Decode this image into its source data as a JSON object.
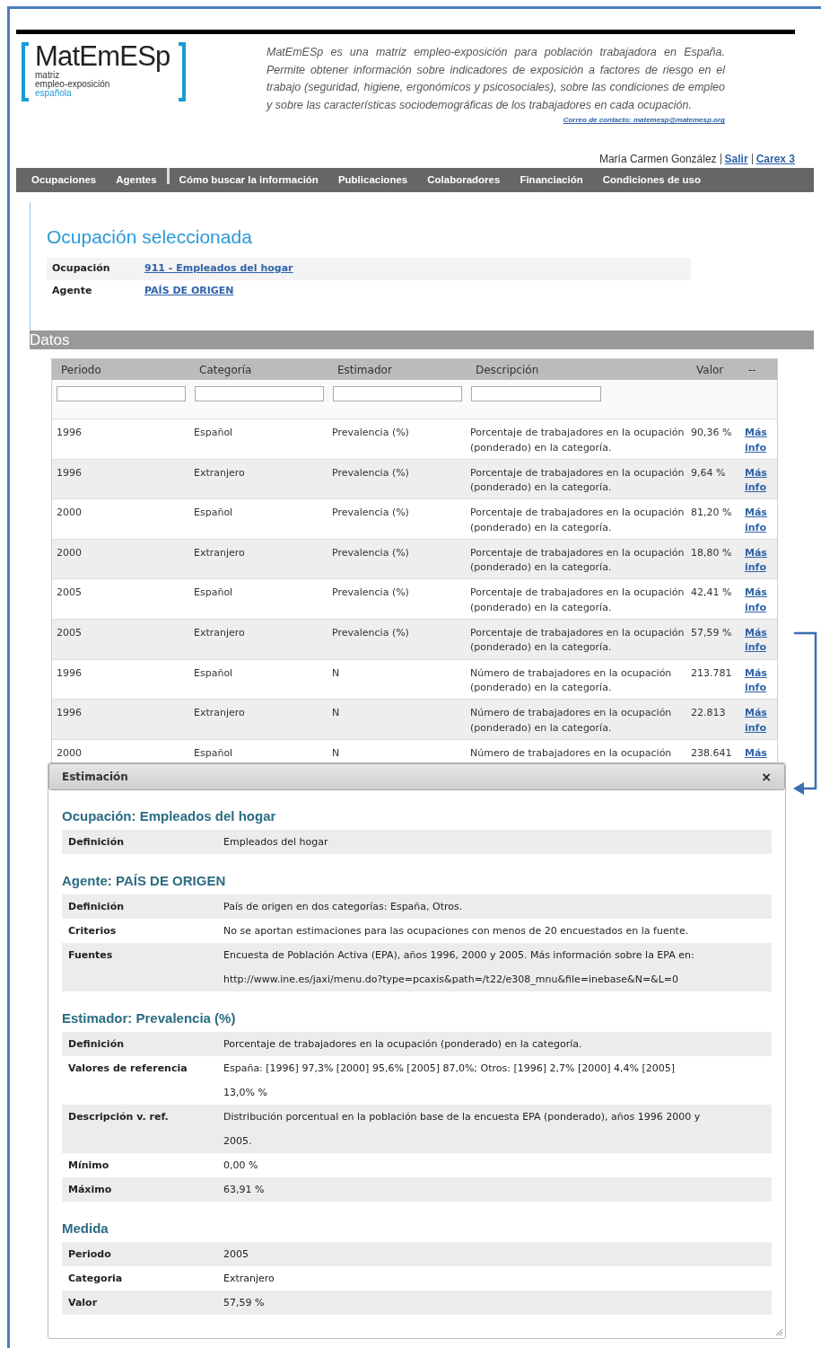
{
  "logo": {
    "title": "MatEmESp",
    "lines": [
      "matriz",
      "empleo-exposición"
    ],
    "accent_line": "española"
  },
  "intro": "MatEmESp es una matriz empleo-exposición para población trabajadora en España. Permite obtener información sobre indicadores de exposición a factores de riesgo en el trabajo (seguridad, higiene, ergonómicos y psicosociales), sobre las condiciones de empleo y sobre las características sociodemográficas de los trabajadores en cada ocupación.",
  "contact": "Correo de contacto: matemesp@matemesp.org",
  "user": {
    "name": "María Carmen González",
    "links": [
      "Salir",
      "Carex 3"
    ]
  },
  "nav": [
    "Ocupaciones",
    "Agentes",
    "Cómo buscar la información",
    "Publicaciones",
    "Colaboradores",
    "Financiación",
    "Condiciones de uso"
  ],
  "selection": {
    "title": "Ocupación seleccionada",
    "rows": [
      {
        "label": "Ocupación",
        "value": "911 - Empleados del hogar"
      },
      {
        "label": "Agente",
        "value": "PAÍS DE ORIGEN"
      }
    ]
  },
  "datos": {
    "title": "Datos",
    "columns": [
      "Periodo",
      "Categoría",
      "Estimador",
      "Descripción",
      "Valor",
      "--"
    ],
    "rows": [
      {
        "periodo": "1996",
        "categoria": "Español",
        "estimador": "Prevalencia (%)",
        "descripcion": "Porcentaje de trabajadores en la ocupación (ponderado) en la categoría.",
        "valor": "90,36 %",
        "link": "Más info"
      },
      {
        "periodo": "1996",
        "categoria": "Extranjero",
        "estimador": "Prevalencia (%)",
        "descripcion": "Porcentaje de trabajadores en la ocupación (ponderado) en la categoría.",
        "valor": "9,64 %",
        "link": "Más info"
      },
      {
        "periodo": "2000",
        "categoria": "Español",
        "estimador": "Prevalencia (%)",
        "descripcion": "Porcentaje de trabajadores en la ocupación (ponderado) en la categoría.",
        "valor": "81,20 %",
        "link": "Más info"
      },
      {
        "periodo": "2000",
        "categoria": "Extranjero",
        "estimador": "Prevalencia (%)",
        "descripcion": "Porcentaje de trabajadores en la ocupación (ponderado) en la categoría.",
        "valor": "18,80 %",
        "link": "Más info"
      },
      {
        "periodo": "2005",
        "categoria": "Español",
        "estimador": "Prevalencia (%)",
        "descripcion": "Porcentaje de trabajadores en la ocupación (ponderado) en la categoría.",
        "valor": "42,41 %",
        "link": "Más info"
      },
      {
        "periodo": "2005",
        "categoria": "Extranjero",
        "estimador": "Prevalencia (%)",
        "descripcion": "Porcentaje de trabajadores en la ocupación (ponderado) en la categoría.",
        "valor": "57,59 %",
        "link": "Más info"
      },
      {
        "periodo": "1996",
        "categoria": "Español",
        "estimador": "N",
        "descripcion": "Número de trabajadores en la ocupación (ponderado) en la categoría.",
        "valor": "213.781",
        "link": "Más info"
      },
      {
        "periodo": "1996",
        "categoria": "Extranjero",
        "estimador": "N",
        "descripcion": "Número de trabajadores en la ocupación (ponderado) en la categoría.",
        "valor": "22.813",
        "link": "Más info"
      },
      {
        "periodo": "2000",
        "categoria": "Español",
        "estimador": "N",
        "descripcion": "Número de trabajadores en la ocupación",
        "valor": "238.641",
        "link": "Más"
      }
    ]
  },
  "dialog": {
    "title": "Estimación",
    "close": "×",
    "sections": [
      {
        "heading": "Ocupación: Empleados del hogar",
        "rows": [
          {
            "label": "Definición",
            "lines": [
              "Empleados del hogar"
            ]
          }
        ]
      },
      {
        "heading": "Agente: PAÍS DE ORIGEN",
        "rows": [
          {
            "label": "Definición",
            "lines": [
              "País de origen en dos categorías: España, Otros."
            ]
          },
          {
            "label": "Criterios",
            "lines": [
              "No se aportan estimaciones para las ocupaciones con menos de 20 encuestados en la fuente."
            ]
          },
          {
            "label": "Fuentes",
            "lines": [
              "Encuesta de Población Activa (EPA), años 1996, 2000 y 2005. Más información sobre la EPA en:",
              "http://www.ine.es/jaxi/menu.do?type=pcaxis&path=/t22/e308_mnu&file=inebase&N=&L=0"
            ]
          }
        ]
      },
      {
        "heading": "Estimador: Prevalencia (%)",
        "rows": [
          {
            "label": "Definición",
            "lines": [
              "Porcentaje de trabajadores en la ocupación (ponderado) en la categoría."
            ]
          },
          {
            "label": "Valores de referencia",
            "lines": [
              "España: [1996] 97,3% [2000] 95,6% [2005] 87,0%; Otros: [1996] 2,7% [2000] 4,4% [2005]",
              "13,0% %"
            ]
          },
          {
            "label": "Descripción v. ref.",
            "lines": [
              "Distribución porcentual en la población base de la encuesta EPA (ponderado), años 1996 2000 y",
              "2005."
            ]
          },
          {
            "label": "Mínimo",
            "lines": [
              "0,00 %"
            ]
          },
          {
            "label": "Máximo",
            "lines": [
              "63,91 %"
            ]
          }
        ]
      },
      {
        "heading": "Medida",
        "rows": [
          {
            "label": "Periodo",
            "lines": [
              "2005"
            ]
          },
          {
            "label": "Categoria",
            "lines": [
              "Extranjero"
            ]
          },
          {
            "label": "Valor",
            "lines": [
              "57,59 %"
            ]
          }
        ]
      }
    ]
  }
}
